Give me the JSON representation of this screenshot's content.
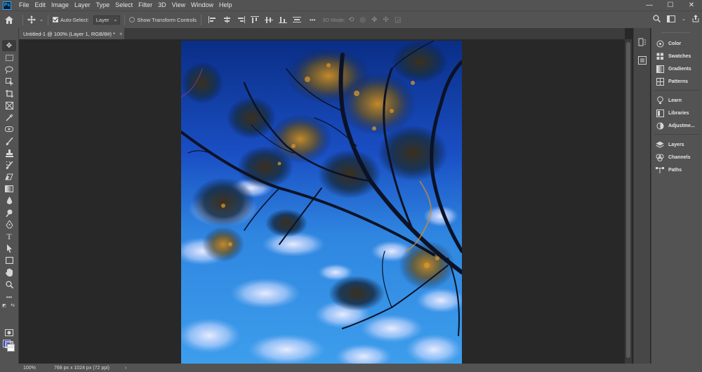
{
  "app": {
    "logo_text": "Ps",
    "menu": [
      "File",
      "Edit",
      "Image",
      "Layer",
      "Type",
      "Select",
      "Filter",
      "3D",
      "View",
      "Window",
      "Help"
    ],
    "window_controls": {
      "minimize": "—",
      "maximize": "☐",
      "close": "✕"
    }
  },
  "options": {
    "auto_select_label": "Auto-Select:",
    "auto_select_checked": true,
    "auto_select_target": "Layer",
    "show_transform_label": "Show Transform Controls",
    "show_transform_checked": false,
    "more_label": "•••",
    "mode_label": "3D Mode:"
  },
  "document": {
    "tab_title": "Untitled-1 @ 100% (Layer 1, RGB/8#) *",
    "close_symbol": "×"
  },
  "status": {
    "zoom": "100%",
    "doc_size": "768 px x 1024 px (72 ppi)",
    "arrow": "›"
  },
  "panels": [
    {
      "label": "Color",
      "icon": "color-wheel-icon"
    },
    {
      "label": "Swatches",
      "icon": "swatches-grid-icon"
    },
    {
      "label": "Gradients",
      "icon": "gradient-icon"
    },
    {
      "label": "Patterns",
      "icon": "pattern-icon"
    },
    {
      "label": "Learn",
      "icon": "lightbulb-icon"
    },
    {
      "label": "Libraries",
      "icon": "library-icon"
    },
    {
      "label": "Adjustme...",
      "icon": "adjustments-icon"
    },
    {
      "label": "Layers",
      "icon": "layers-icon"
    },
    {
      "label": "Channels",
      "icon": "channels-icon"
    },
    {
      "label": "Paths",
      "icon": "paths-icon"
    }
  ],
  "colors": {
    "foreground": "#2a3db8",
    "background": "#ffffff"
  }
}
